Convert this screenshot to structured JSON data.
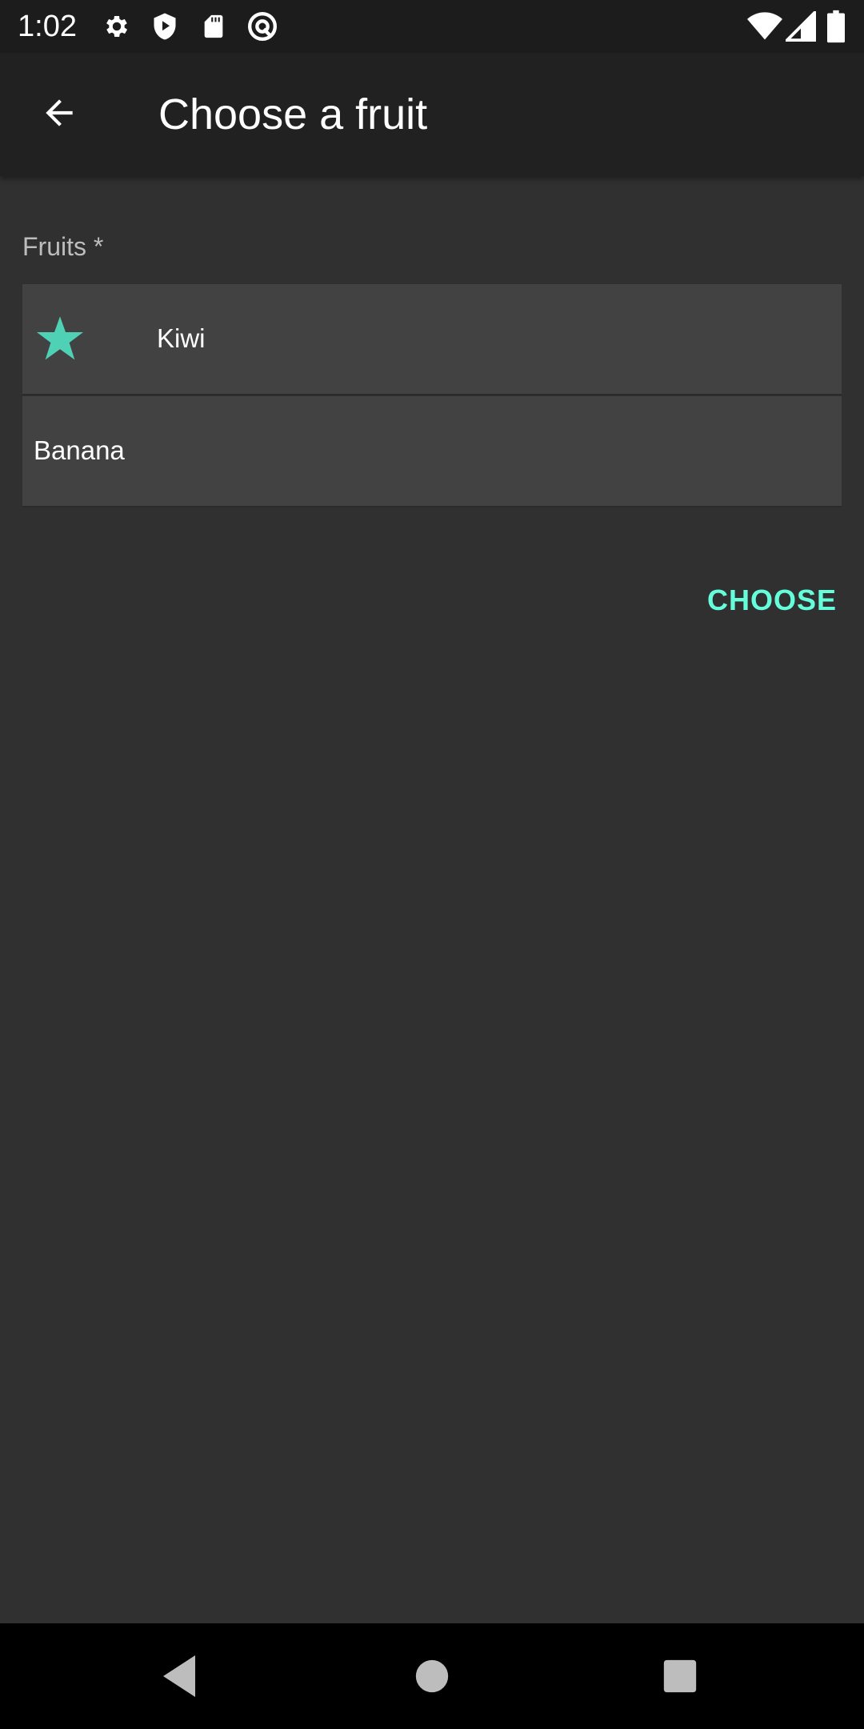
{
  "status_bar": {
    "time": "1:02",
    "icons": [
      "gear-icon",
      "shield-play-icon",
      "sd-card-icon",
      "at-sign-icon",
      "wifi-icon",
      "signal-icon",
      "battery-icon"
    ]
  },
  "app_bar": {
    "title": "Choose a fruit",
    "back_icon": "arrow-back-icon"
  },
  "form": {
    "label": "Fruits *",
    "items": [
      {
        "label": "Kiwi",
        "icon": "star-icon",
        "starred": true
      },
      {
        "label": "Banana",
        "starred": false
      }
    ],
    "choose_label": "CHOOSE"
  },
  "nav_bar": {
    "icons": [
      "nav-back-icon",
      "nav-home-icon",
      "nav-recents-icon"
    ]
  },
  "colors": {
    "accent": "#64ffda",
    "star": "#4fd1b5",
    "background": "#303030",
    "app_bar": "#212121",
    "list_item": "#424242"
  }
}
